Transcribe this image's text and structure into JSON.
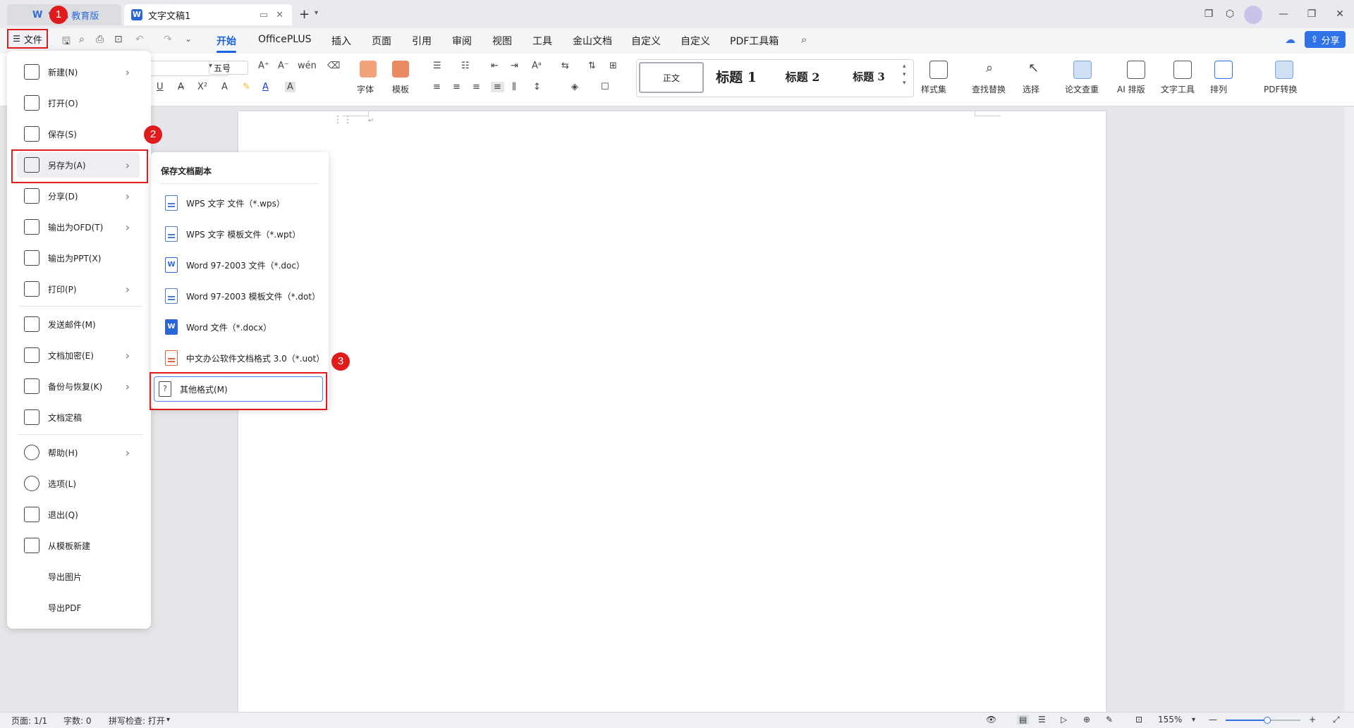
{
  "titlebar": {
    "home_tab": "WPS 教育版",
    "doc_tab": "文字文稿1",
    "new_tab_icon": "plus-icon"
  },
  "menubar": {
    "file_label": "文件",
    "tabs": [
      "开始",
      "OfficePLUS",
      "插入",
      "页面",
      "引用",
      "审阅",
      "视图",
      "工具",
      "金山文档",
      "自定义",
      "自定义",
      "PDF工具箱"
    ],
    "active_tab": "开始",
    "share_label": "分享"
  },
  "ribbon": {
    "font_size": "五号",
    "font_btn": "字体",
    "template_btn": "模板",
    "styles": [
      "正文",
      "标题 1",
      "标题 2",
      "标题 3"
    ],
    "style_set": "样式集",
    "find_replace": "查找替换",
    "select": "选择",
    "paper_check": "论文查重",
    "ai_layout": "AI 排版",
    "text_tools": "文字工具",
    "arrange": "排列",
    "pdf_convert": "PDF转换"
  },
  "file_menu": {
    "items": [
      {
        "label": "新建(N)",
        "arrow": true
      },
      {
        "label": "打开(O)",
        "arrow": false
      },
      {
        "label": "保存(S)",
        "arrow": false
      },
      {
        "label": "另存为(A)",
        "arrow": true
      },
      {
        "label": "分享(D)",
        "arrow": true
      },
      {
        "label": "输出为OFD(T)",
        "arrow": true
      },
      {
        "label": "输出为PPT(X)",
        "arrow": false
      },
      {
        "label": "打印(P)",
        "arrow": true
      },
      {
        "label": "发送邮件(M)",
        "arrow": false
      },
      {
        "label": "文档加密(E)",
        "arrow": true
      },
      {
        "label": "备份与恢复(K)",
        "arrow": true
      },
      {
        "label": "文档定稿",
        "arrow": false
      },
      {
        "label": "帮助(H)",
        "arrow": true
      },
      {
        "label": "选项(L)",
        "arrow": false
      },
      {
        "label": "退出(Q)",
        "arrow": false
      },
      {
        "label": "从模板新建",
        "arrow": false
      },
      {
        "label": "导出图片",
        "arrow": false
      },
      {
        "label": "导出PDF",
        "arrow": false
      }
    ]
  },
  "submenu": {
    "heading": "保存文档副本",
    "items": [
      "WPS 文字 文件（*.wps）",
      "WPS 文字 模板文件（*.wpt）",
      "Word 97-2003 文件（*.doc）",
      "Word 97-2003 模板文件（*.dot）",
      "Word 文件（*.docx）",
      "中文办公软件文档格式 3.0（*.uot）",
      "其他格式(M)"
    ]
  },
  "annotations": [
    "1",
    "2",
    "3"
  ],
  "statusbar": {
    "page": "页面: 1/1",
    "words": "字数: 0",
    "spell": "拼写检查: 打开",
    "zoom": "155%"
  },
  "colors": {
    "accent": "#1a62e0",
    "annotation_red": "#e11b1b"
  }
}
